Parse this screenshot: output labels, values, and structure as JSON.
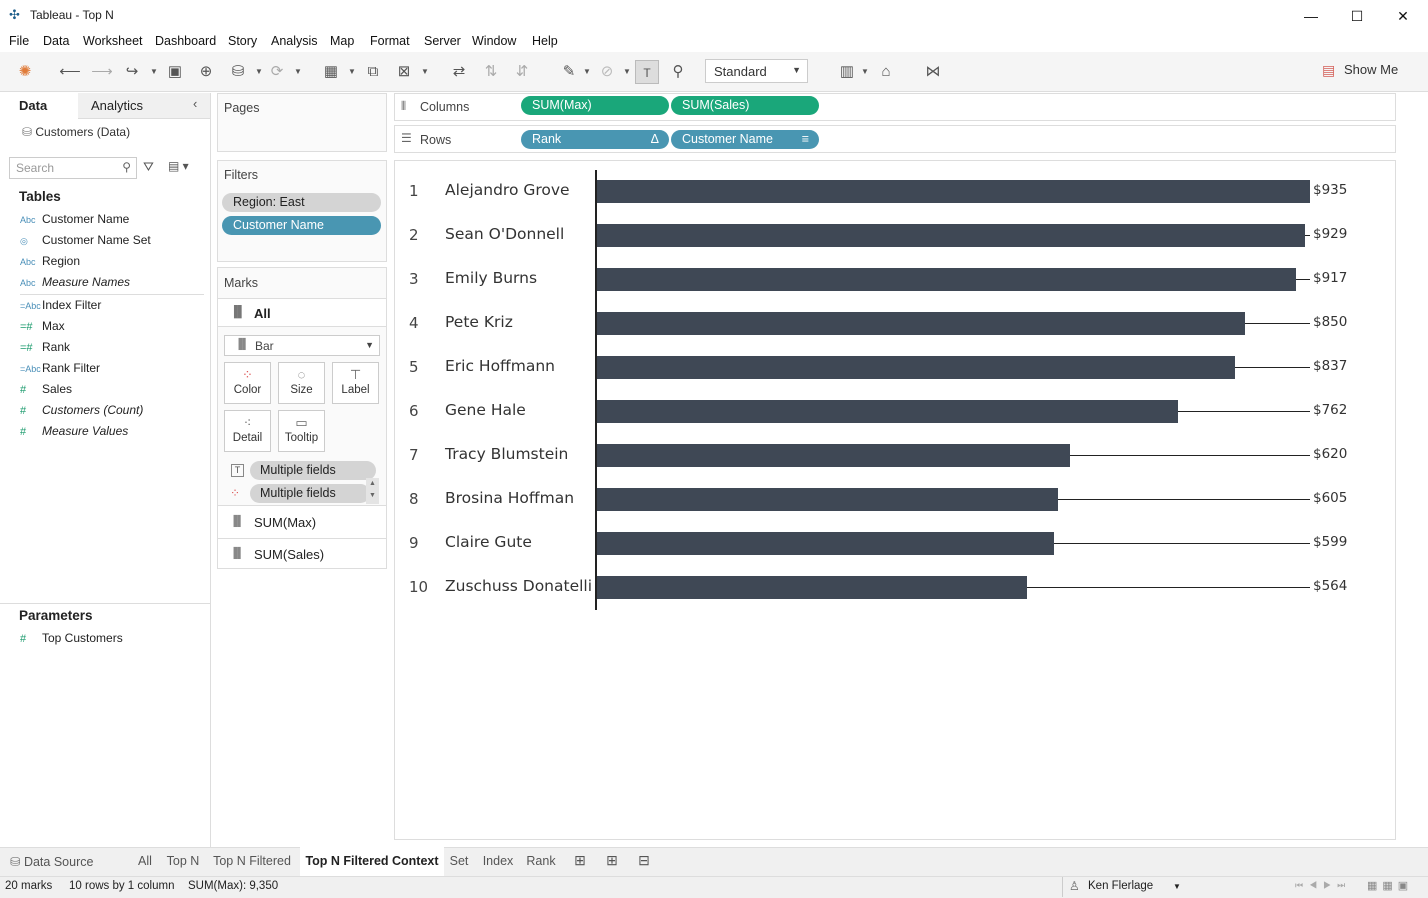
{
  "window": {
    "title": "Tableau - Top N",
    "minimize": "—",
    "maximize": "☐",
    "close": "✕"
  },
  "menu": [
    "File",
    "Data",
    "Worksheet",
    "Dashboard",
    "Story",
    "Analysis",
    "Map",
    "Format",
    "Server",
    "Window",
    "Help"
  ],
  "toolbar": {
    "fit_mode": "Standard",
    "show_me": "Show Me"
  },
  "left": {
    "tab_data": "Data",
    "tab_analytics": "Analytics",
    "datasource": "Customers (Data)",
    "search_placeholder": "Search",
    "tables_heading": "Tables",
    "fields": [
      {
        "name": "Customer Name",
        "type": "Abc",
        "italic": false
      },
      {
        "name": "Customer Name Set",
        "type": "set",
        "italic": false
      },
      {
        "name": "Region",
        "type": "Abc",
        "italic": false
      },
      {
        "name": "Measure Names",
        "type": "Abc",
        "italic": true
      },
      {
        "name": "Index Filter",
        "type": "=Abc",
        "italic": false
      },
      {
        "name": "Max",
        "type": "=#",
        "italic": false
      },
      {
        "name": "Rank",
        "type": "=#",
        "italic": false
      },
      {
        "name": "Rank Filter",
        "type": "=Abc",
        "italic": false
      },
      {
        "name": "Sales",
        "type": "#",
        "italic": false
      },
      {
        "name": "Customers (Count)",
        "type": "#",
        "italic": true
      },
      {
        "name": "Measure Values",
        "type": "#",
        "italic": true
      }
    ],
    "parameters_heading": "Parameters",
    "parameters": [
      {
        "name": "Top Customers",
        "type": "#"
      }
    ]
  },
  "cards": {
    "pages": "Pages",
    "filters": "Filters",
    "filter_pills": [
      "Region: East",
      "Customer Name"
    ],
    "marks": "Marks",
    "marks_all": "All",
    "mark_type": "Bar",
    "mark_buttons": [
      "Color",
      "Size",
      "Label",
      "Detail",
      "Tooltip"
    ],
    "mark_fields": [
      "Multiple fields",
      "Multiple fields"
    ],
    "measure_tabs": [
      "SUM(Max)",
      "SUM(Sales)"
    ]
  },
  "shelves": {
    "columns_label": "Columns",
    "columns": [
      "SUM(Max)",
      "SUM(Sales)"
    ],
    "rows_label": "Rows",
    "rows": [
      "Rank",
      "Customer Name"
    ],
    "rows_icons": [
      "Δ",
      "≡"
    ]
  },
  "chart_data": {
    "type": "bar",
    "categories": [
      "Alejandro Grove",
      "Sean O'Donnell",
      "Emily Burns",
      "Pete Kriz",
      "Eric Hoffmann",
      "Gene Hale",
      "Tracy Blumstein",
      "Brosina Hoffman",
      "Claire Gute",
      "Zuschuss Donatelli"
    ],
    "ranks": [
      "1",
      "2",
      "3",
      "4",
      "5",
      "6",
      "7",
      "8",
      "9",
      "10"
    ],
    "series": [
      {
        "name": "SUM(Sales)",
        "values": [
          935,
          929,
          917,
          850,
          837,
          762,
          620,
          605,
          599,
          564
        ]
      }
    ],
    "labels": [
      "$935",
      "$929",
      "$917",
      "$850",
      "$837",
      "$762",
      "$620",
      "$605",
      "$599",
      "$564"
    ],
    "max": 935,
    "xlim": [
      0,
      935
    ],
    "bar_color": "#3f4855"
  },
  "sheet_tabs": [
    "Data Source",
    "All",
    "Top N",
    "Top N Filtered",
    "Top N Filtered Context",
    "Set",
    "Index",
    "Rank"
  ],
  "status": {
    "marks": "20 marks",
    "dims": "10 rows by 1 column",
    "sum": "SUM(Max): 9,350",
    "user": "Ken Flerlage"
  }
}
